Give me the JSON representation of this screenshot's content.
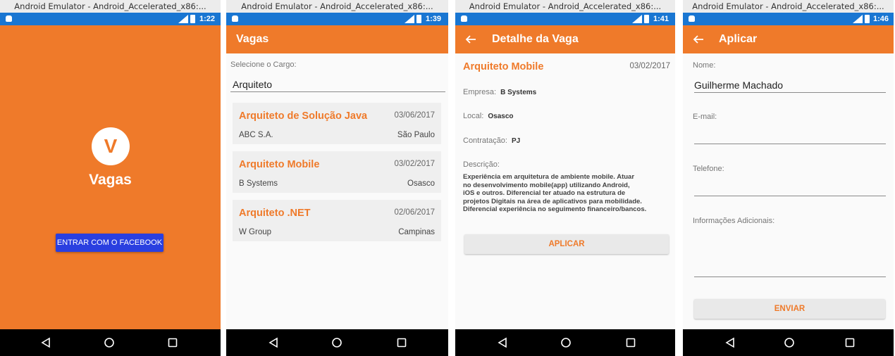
{
  "window_title": "Android Emulator - Android_Accelerated_x86:...",
  "colors": {
    "accent": "#ef7a2a",
    "status_bar": "#1976d2",
    "facebook_button": "#2a3fe0"
  },
  "screens": [
    {
      "time": "1:22",
      "logo_letter": "V",
      "app_name": "Vagas",
      "facebook_button": "ENTRAR COM O FACEBOOK"
    },
    {
      "time": "1:39",
      "title": "Vagas",
      "select_label": "Selecione o Cargo:",
      "select_value": "Arquiteto",
      "jobs": [
        {
          "title": "Arquiteto de Solução Java",
          "date": "03/06/2017",
          "company": "ABC S.A.",
          "location": "São Paulo"
        },
        {
          "title": "Arquiteto Mobile",
          "date": "03/02/2017",
          "company": "B Systems",
          "location": "Osasco"
        },
        {
          "title": "Arquiteto .NET",
          "date": "02/06/2017",
          "company": "W Group",
          "location": "Campinas"
        }
      ]
    },
    {
      "time": "1:41",
      "title": "Detalhe da Vaga",
      "job_title": "Arquiteto Mobile",
      "date": "03/02/2017",
      "company_label": "Empresa:",
      "company": "B Systems",
      "location_label": "Local:",
      "location": "Osasco",
      "contract_label": "Contratação:",
      "contract": "PJ",
      "description_label": "Descrição:",
      "description_lines": [
        "Experiência em arquitetura de ambiente mobile. Atuar",
        "no desenvolvimento mobile(app) utilizando Android,",
        "iOS e outros. Diferencial ter atuado na estrutura de",
        "projetos Digitais na área de aplicativos para mobilidade.",
        "Diferencial experiência no seguimento financeiro/bancos."
      ],
      "apply_button": "APLICAR"
    },
    {
      "time": "1:46",
      "title": "Aplicar",
      "name_label": "Nome:",
      "name_value": "Guilherme Machado",
      "email_label": "E-mail:",
      "email_value": "",
      "phone_label": "Telefone:",
      "phone_value": "",
      "info_label": "Informações Adicionais:",
      "info_value": "",
      "send_button": "ENVIAR"
    }
  ],
  "icons": {
    "back": "arrow-left-icon",
    "nav_back": "triangle-back-icon",
    "nav_home": "circle-home-icon",
    "nav_recent": "square-recent-icon"
  }
}
